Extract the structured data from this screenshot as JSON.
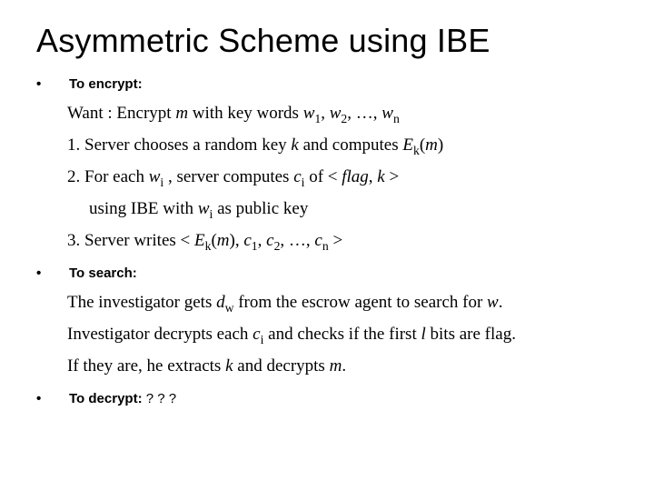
{
  "title": "Asymmetric Scheme using IBE",
  "sections": {
    "encrypt": {
      "heading": "To encrypt:",
      "lines": {
        "want": "Want : Encrypt m with key words w₁, w₂, …, wₙ",
        "step1": "1. Server chooses a random key k and computes Eₖ(m)",
        "step2a": "2. For each wᵢ , server computes cᵢ of < flag, k >",
        "step2b": "using IBE with wᵢ as public key",
        "step3": "3. Server writes < Eₖ(m), c₁, c₂, …, cₙ >"
      }
    },
    "search": {
      "heading": "To search:",
      "lines": {
        "l1": "The investigator gets d_w from the escrow agent to search for w.",
        "l2": "Investigator decrypts each cᵢ and checks if the first l bits are flag.",
        "l3": "If they are, he extracts k and decrypts m."
      }
    },
    "decrypt": {
      "heading": "To decrypt:",
      "note": "? ? ?"
    }
  }
}
